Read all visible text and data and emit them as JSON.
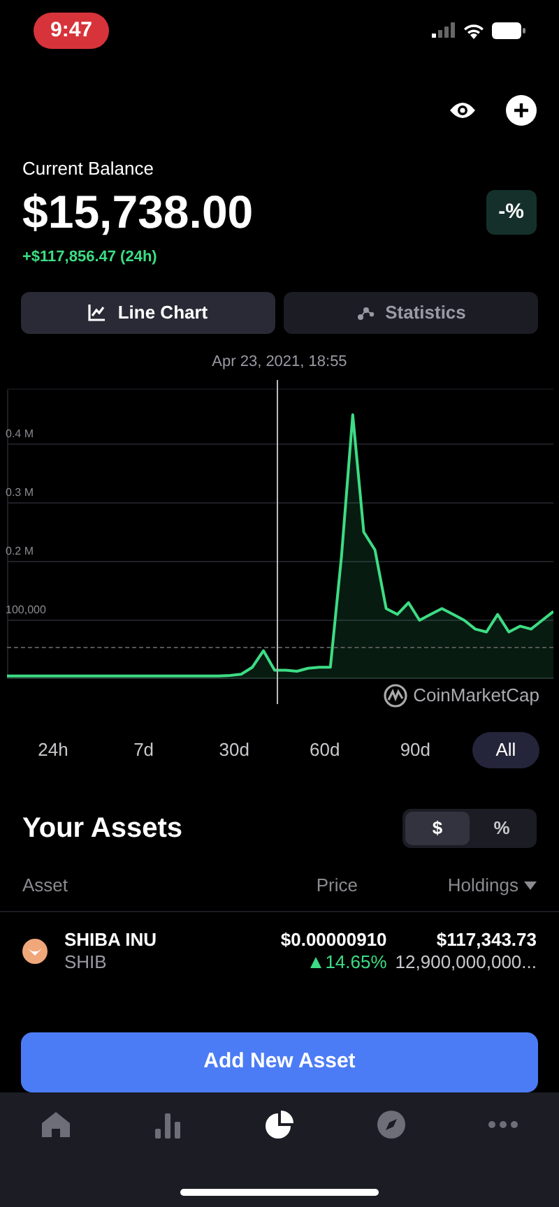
{
  "status_bar": {
    "time": "9:47"
  },
  "balance": {
    "label": "Current Balance",
    "amount": "$15,738.00",
    "change": "+$117,856.47 (24h)",
    "percent_badge": "-%"
  },
  "view_tabs": [
    {
      "label": "Line Chart",
      "selected": true
    },
    {
      "label": "Statistics",
      "selected": false
    }
  ],
  "chart": {
    "crosshair_date": "Apr 23, 2021, 18:55",
    "source": "CoinMarketCap",
    "chart_data": {
      "type": "area",
      "grid": true,
      "ylim": [
        0,
        495000
      ],
      "yticks": [
        {
          "value": 100000,
          "label": "100,000"
        },
        {
          "value": 200000,
          "label": "0.2 M"
        },
        {
          "value": 300000,
          "label": "0.3 M"
        },
        {
          "value": 400000,
          "label": "0.4 M"
        }
      ],
      "series": [
        {
          "color": "#3ddc84",
          "values": [
            5000,
            5000,
            5000,
            5000,
            5000,
            5000,
            5000,
            5000,
            5000,
            5000,
            5000,
            5000,
            5000,
            5000,
            5000,
            5000,
            5000,
            5000,
            5000,
            5000,
            6000,
            8000,
            20000,
            48000,
            15000,
            15000,
            13000,
            18000,
            20000,
            20000,
            210000,
            450000,
            250000,
            220000,
            120000,
            110000,
            130000,
            100000,
            110000,
            120000,
            110000,
            100000,
            85000,
            80000,
            110000,
            80000,
            90000,
            85000,
            100000,
            115000
          ]
        }
      ]
    }
  },
  "ranges": [
    {
      "label": "24h",
      "selected": false
    },
    {
      "label": "7d",
      "selected": false
    },
    {
      "label": "30d",
      "selected": false
    },
    {
      "label": "60d",
      "selected": false
    },
    {
      "label": "90d",
      "selected": false
    },
    {
      "label": "All",
      "selected": true
    }
  ],
  "assets": {
    "title": "Your Assets",
    "units": [
      {
        "label": "$",
        "selected": true
      },
      {
        "label": "%",
        "selected": false
      }
    ],
    "columns": [
      "Asset",
      "Price",
      "Holdings"
    ],
    "rows": [
      {
        "name": "SHIBA INU",
        "symbol": "SHIB",
        "price": "$0.00000910",
        "change": "14.65%",
        "holdings_value": "$117,343.73",
        "holdings_amount": "12,900,000,000..."
      }
    ]
  },
  "add_button": "Add New Asset",
  "bottom_nav": [
    {
      "kind": "home",
      "selected": false
    },
    {
      "kind": "bars",
      "selected": false
    },
    {
      "kind": "pie",
      "selected": true
    },
    {
      "kind": "compass",
      "selected": false
    },
    {
      "kind": "more",
      "selected": false
    }
  ]
}
